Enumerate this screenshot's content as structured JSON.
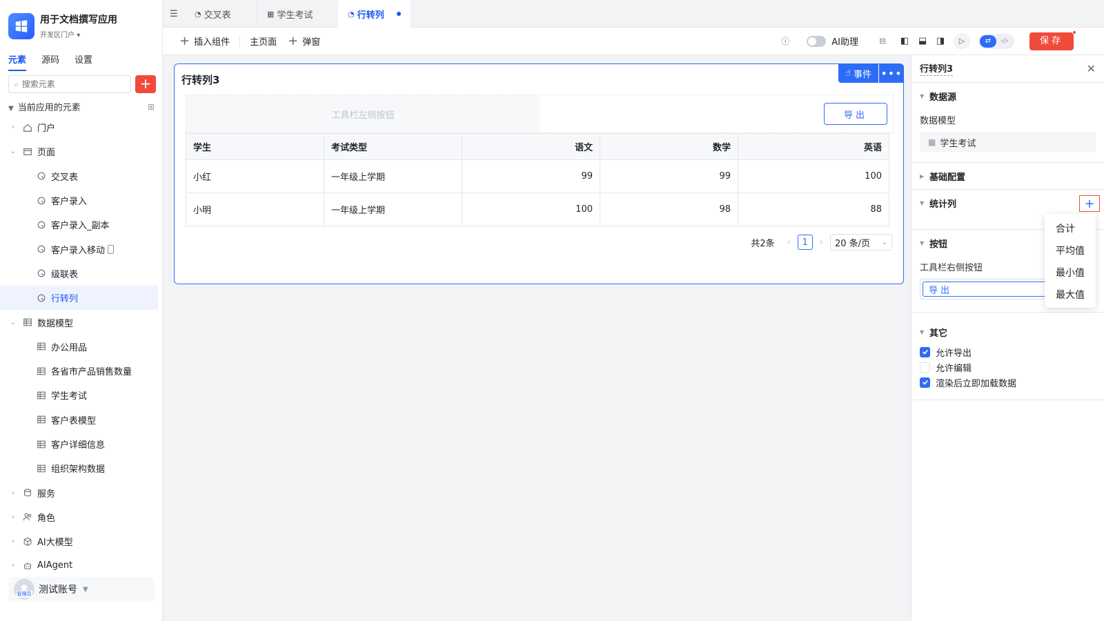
{
  "app": {
    "title": "用于文档撰写应用",
    "subtitle": "开发区门户"
  },
  "sidebar": {
    "tabs": [
      {
        "label": "元素",
        "active": true
      },
      {
        "label": "源码"
      },
      {
        "label": "设置"
      }
    ],
    "search_placeholder": "搜索元素",
    "section_title": "当前应用的元素",
    "items": [
      {
        "label": "门户",
        "level": 1,
        "caret": "›",
        "icon": "home-icon"
      },
      {
        "label": "页面",
        "level": 1,
        "caret": "⌄",
        "icon": "page-icon"
      },
      {
        "label": "交叉表",
        "level": 2,
        "icon": "page-item-icon"
      },
      {
        "label": "客户录入",
        "level": 2,
        "icon": "page-item-icon"
      },
      {
        "label": "客户录入_副本",
        "level": 2,
        "icon": "page-item-icon"
      },
      {
        "label": "客户录入移动",
        "level": 2,
        "icon": "page-item-icon"
      },
      {
        "label": "级联表",
        "level": 2,
        "icon": "page-item-icon"
      },
      {
        "label": "行转列",
        "level": 2,
        "icon": "page-item-icon",
        "active": true
      },
      {
        "label": "数据模型",
        "level": 1,
        "caret": "⌄",
        "icon": "table-icon"
      },
      {
        "label": "办公用品",
        "level": 2,
        "icon": "table-icon"
      },
      {
        "label": "各省市产品销售数量",
        "level": 2,
        "icon": "table-icon"
      },
      {
        "label": "学生考试",
        "level": 2,
        "icon": "table-icon"
      },
      {
        "label": "客户表模型",
        "level": 2,
        "icon": "table-icon"
      },
      {
        "label": "客户详细信息",
        "level": 2,
        "icon": "table-icon"
      },
      {
        "label": "组织架构数据",
        "level": 2,
        "icon": "table-icon"
      },
      {
        "label": "服务",
        "level": 1,
        "caret": "›",
        "icon": "service-icon"
      },
      {
        "label": "角色",
        "level": 1,
        "caret": "›",
        "icon": "role-icon"
      },
      {
        "label": "AI大模型",
        "level": 1,
        "caret": "›",
        "icon": "ai-model-icon"
      },
      {
        "label": "AIAgent",
        "level": 1,
        "caret": "›",
        "icon": "robot-icon"
      }
    ],
    "user": {
      "name": "测试账号",
      "badge": "管理员"
    }
  },
  "tabs": [
    {
      "label": "交叉表",
      "icon": "page-item-icon"
    },
    {
      "label": "学生考试",
      "icon": "table-icon"
    },
    {
      "label": "行转列",
      "icon": "page-item-icon",
      "active": true
    }
  ],
  "toolbar": {
    "insert": "插入组件",
    "main_page": "主页面",
    "popup": "弹窗",
    "ai_assist": "AI助理",
    "save": "保存"
  },
  "canvas": {
    "title": "行转列3",
    "event_btn": "事件",
    "toolbar_left_placeholder": "工具栏左侧按钮",
    "export_btn": "导出",
    "table": {
      "columns": [
        "学生",
        "考试类型",
        "语文",
        "数学",
        "英语"
      ],
      "rows": [
        [
          "小红",
          "一年级上学期",
          "99",
          "99",
          "100"
        ],
        [
          "小明",
          "一年级上学期",
          "100",
          "98",
          "88"
        ]
      ]
    },
    "pager": {
      "total": "共2条",
      "page": "1",
      "size": "20 条/页"
    }
  },
  "panel": {
    "title": "行转列3",
    "datasource": {
      "title": "数据源",
      "model_label": "数据模型",
      "model_value": "学生考试"
    },
    "basic": {
      "title": "基础配置"
    },
    "stats": {
      "title": "统计列"
    },
    "buttons": {
      "title": "按钮",
      "right_label": "工具栏右侧按钮",
      "right_value": "导出"
    },
    "other": {
      "title": "其它",
      "options": [
        {
          "label": "允许导出",
          "checked": true
        },
        {
          "label": "允许编辑",
          "checked": false
        },
        {
          "label": "渲染后立即加载数据",
          "checked": true
        }
      ]
    }
  },
  "dropdown": {
    "items": [
      "合计",
      "平均值",
      "最小值",
      "最大值"
    ]
  },
  "colors": {
    "accent": "#2d6cf6",
    "danger": "#f04b3a"
  }
}
